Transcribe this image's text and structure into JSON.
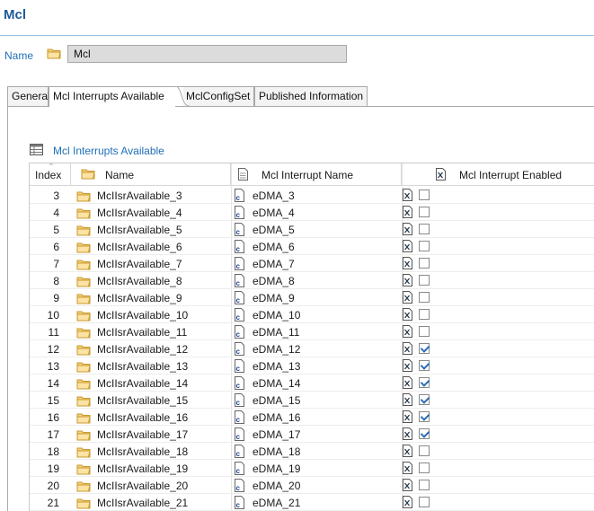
{
  "header": {
    "title": "Mcl"
  },
  "name_field": {
    "label": "Name",
    "value": "Mcl"
  },
  "tabs": [
    {
      "label": "General"
    },
    {
      "label": "Mcl Interrupts Available"
    },
    {
      "label": "MclConfigSet"
    },
    {
      "label": "Published Information"
    }
  ],
  "active_tab": "Mcl Interrupts Available",
  "section": {
    "title": "Mcl Interrupts Available"
  },
  "table": {
    "columns": [
      "Index",
      "Name",
      "Mcl Interrupt Name",
      "Mcl Interrupt Enabled"
    ],
    "rows": [
      {
        "index": "3",
        "name": "McIIsrAvailable_3",
        "irq": "eDMA_3",
        "enabled": false
      },
      {
        "index": "4",
        "name": "McIIsrAvailable_4",
        "irq": "eDMA_4",
        "enabled": false
      },
      {
        "index": "5",
        "name": "McIIsrAvailable_5",
        "irq": "eDMA_5",
        "enabled": false
      },
      {
        "index": "6",
        "name": "McIIsrAvailable_6",
        "irq": "eDMA_6",
        "enabled": false
      },
      {
        "index": "7",
        "name": "McIIsrAvailable_7",
        "irq": "eDMA_7",
        "enabled": false
      },
      {
        "index": "8",
        "name": "McIIsrAvailable_8",
        "irq": "eDMA_8",
        "enabled": false
      },
      {
        "index": "9",
        "name": "McIIsrAvailable_9",
        "irq": "eDMA_9",
        "enabled": false
      },
      {
        "index": "10",
        "name": "McIIsrAvailable_10",
        "irq": "eDMA_10",
        "enabled": false
      },
      {
        "index": "11",
        "name": "McIIsrAvailable_11",
        "irq": "eDMA_11",
        "enabled": false
      },
      {
        "index": "12",
        "name": "McIIsrAvailable_12",
        "irq": "eDMA_12",
        "enabled": true
      },
      {
        "index": "13",
        "name": "McIIsrAvailable_13",
        "irq": "eDMA_13",
        "enabled": true
      },
      {
        "index": "14",
        "name": "McIIsrAvailable_14",
        "irq": "eDMA_14",
        "enabled": true
      },
      {
        "index": "15",
        "name": "McIIsrAvailable_15",
        "irq": "eDMA_15",
        "enabled": true
      },
      {
        "index": "16",
        "name": "McIIsrAvailable_16",
        "irq": "eDMA_16",
        "enabled": true
      },
      {
        "index": "17",
        "name": "McIIsrAvailable_17",
        "irq": "eDMA_17",
        "enabled": true
      },
      {
        "index": "18",
        "name": "McIIsrAvailable_18",
        "irq": "eDMA_18",
        "enabled": false
      },
      {
        "index": "19",
        "name": "McIIsrAvailable_19",
        "irq": "eDMA_19",
        "enabled": false
      },
      {
        "index": "20",
        "name": "McIIsrAvailable_20",
        "irq": "eDMA_20",
        "enabled": false
      },
      {
        "index": "21",
        "name": "McIIsrAvailable_21",
        "irq": "eDMA_21",
        "enabled": false
      }
    ]
  },
  "icons": {
    "name_field": "folder-icon",
    "section": "table-icon",
    "row_name": "folder-icon",
    "row_irq": "c-file-icon",
    "row_enabled": "boolean-x-icon"
  },
  "colors": {
    "accent": "#1f6fb8",
    "title": "#1f5a9a",
    "check": "#2a6fb5"
  }
}
